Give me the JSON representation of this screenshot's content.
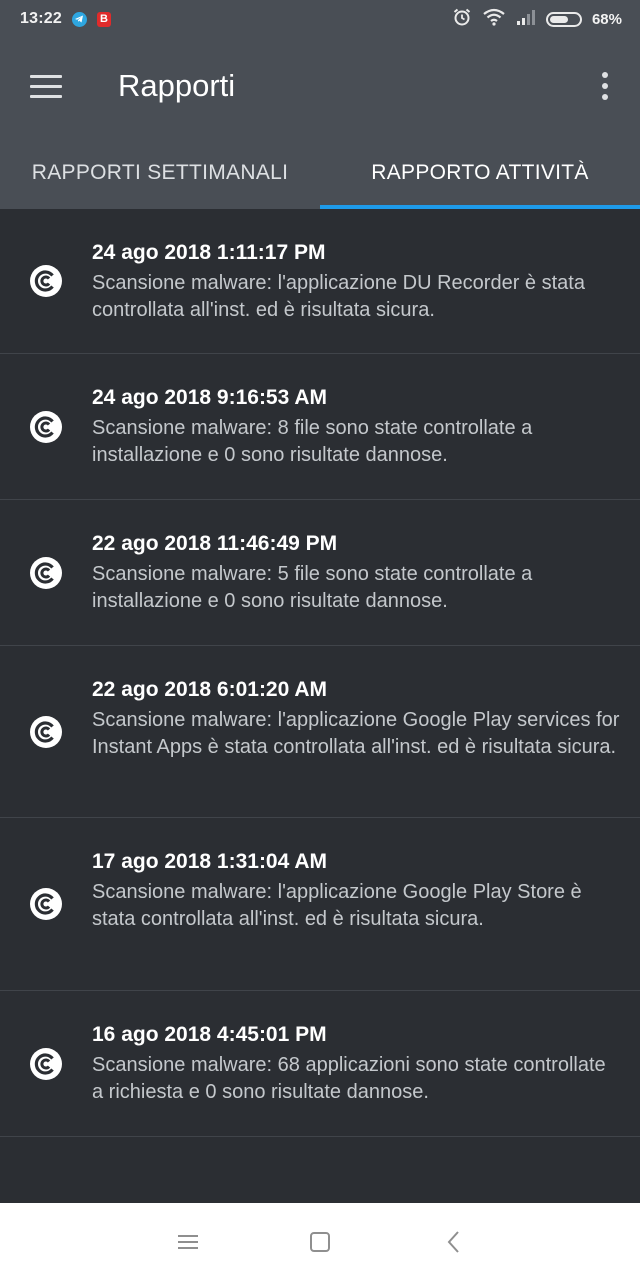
{
  "status_bar": {
    "time": "13:22",
    "battery_percent": "68%",
    "battery_level": 0.68,
    "badge_letter": "B",
    "icons": [
      "telegram-icon",
      "b-app-icon",
      "alarm-icon",
      "wifi-icon",
      "signal-icon",
      "battery-icon"
    ]
  },
  "app_bar": {
    "title": "Rapporti",
    "icons": [
      "menu-icon",
      "overflow-menu-icon"
    ]
  },
  "tabs": [
    {
      "label": "RAPPORTI SETTIMANALI",
      "active": false
    },
    {
      "label": "RAPPORTO ATTIVITÀ",
      "active": true
    }
  ],
  "colors": {
    "accent": "#1e9bea",
    "header_bg": "#494e55",
    "list_bg": "#2b2e33"
  },
  "reports": [
    {
      "icon": "scan-shield-icon",
      "date": "24 ago 2018 1:11:17 PM",
      "description": "Scansione malware: l'applicazione DU Recorder è stata controllata all'inst. ed è risultata sicura."
    },
    {
      "icon": "scan-shield-icon",
      "date": "24 ago 2018 9:16:53 AM",
      "description": "Scansione malware: 8 file sono state controllate a installazione e 0 sono risultate dannose."
    },
    {
      "icon": "scan-shield-icon",
      "date": "22 ago 2018 11:46:49 PM",
      "description": "Scansione malware: 5 file sono state controllate a installazione e 0 sono risultate dannose."
    },
    {
      "icon": "scan-shield-icon",
      "date": "22 ago 2018 6:01:20 AM",
      "description": "Scansione malware: l'applicazione Google Play services for Instant Apps è stata controllata all'inst. ed è risultata sicura."
    },
    {
      "icon": "scan-shield-icon",
      "date": "17 ago 2018 1:31:04 AM",
      "description": "Scansione malware: l'applicazione Google Play Store è stata controllata all'inst. ed è risultata sicura."
    },
    {
      "icon": "scan-shield-icon",
      "date": "16 ago 2018 4:45:01 PM",
      "description": "Scansione malware: 68 applicazioni sono state controllate a richiesta e 0 sono risultate dannose."
    }
  ],
  "nav_bar": {
    "icons": [
      "recents-icon",
      "home-icon",
      "back-icon"
    ]
  }
}
